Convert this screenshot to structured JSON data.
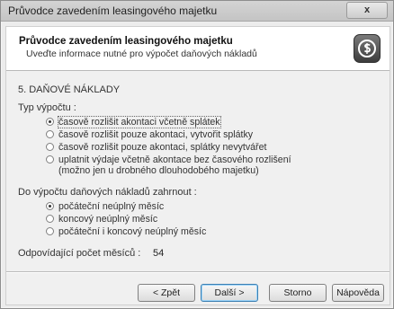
{
  "window": {
    "title": "Průvodce zavedením leasingového majetku",
    "close_label": "x"
  },
  "header": {
    "title": "Průvodce zavedením leasingového majetku",
    "subtitle": "Uveďte informace nutné pro výpočet daňových nákladů",
    "logo_icon": "dollar-icon"
  },
  "section_title": "5. DAŇOVÉ NÁKLADY",
  "calc_type": {
    "label": "Typ výpočtu :",
    "options": [
      {
        "label": "časově rozlišit akontaci včetně splátek",
        "selected": true
      },
      {
        "label": "časově rozlišit pouze akontaci, vytvořit splátky",
        "selected": false
      },
      {
        "label": "časově rozlišit pouze akontaci, splátky nevytvářet",
        "selected": false
      },
      {
        "label": "uplatnit výdaje včetně akontace bez časového rozlišení\n(možno jen u drobného dlouhodobého majetku)",
        "selected": false
      }
    ]
  },
  "tax_include": {
    "label": "Do výpočtu daňových nákladů zahrnout :",
    "options": [
      {
        "label": "počáteční neúplný měsíc",
        "selected": true
      },
      {
        "label": "koncový neúplný měsíc",
        "selected": false
      },
      {
        "label": "počáteční i koncový neúplný měsíc",
        "selected": false
      }
    ]
  },
  "month_count": {
    "label": "Odpovídající počet měsíců :",
    "value": "54"
  },
  "buttons": {
    "back": "< Zpět",
    "next": "Další >",
    "cancel": "Storno",
    "help": "Nápověda"
  }
}
